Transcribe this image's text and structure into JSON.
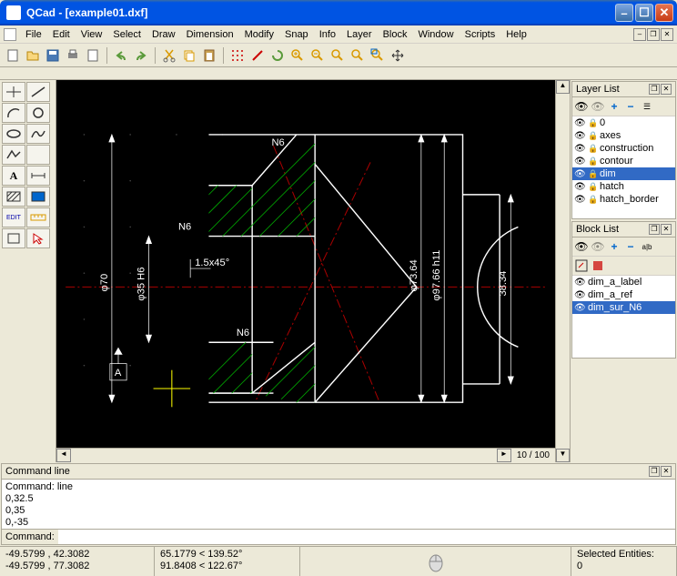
{
  "window": {
    "title": "QCad - [example01.dxf]"
  },
  "menu": [
    "File",
    "Edit",
    "View",
    "Select",
    "Draw",
    "Dimension",
    "Modify",
    "Snap",
    "Info",
    "Layer",
    "Block",
    "Window",
    "Scripts",
    "Help"
  ],
  "layers": {
    "title": "Layer List",
    "items": [
      {
        "name": "0",
        "sel": false
      },
      {
        "name": "axes",
        "sel": false
      },
      {
        "name": "construction",
        "sel": false
      },
      {
        "name": "contour",
        "sel": false
      },
      {
        "name": "dim",
        "sel": true
      },
      {
        "name": "hatch",
        "sel": false
      },
      {
        "name": "hatch_border",
        "sel": false
      }
    ]
  },
  "blocks": {
    "title": "Block List",
    "items": [
      {
        "name": "dim_a_label",
        "sel": false
      },
      {
        "name": "dim_a_ref",
        "sel": false
      },
      {
        "name": "dim_sur_N6",
        "sel": true
      }
    ]
  },
  "cmd": {
    "title": "Command line",
    "history": [
      "Command: line",
      "0,32.5",
      "0,35",
      "0,-35"
    ],
    "label": "Command:"
  },
  "status": {
    "coord1a": "-49.5799 , 42.3082",
    "coord1b": "-49.5799 , 77.3082",
    "coord2a": "65.1779 < 139.52°",
    "coord2b": "91.8408 < 122.67°",
    "sel_label": "Selected Entities:",
    "sel_count": "0"
  },
  "viewport": {
    "ratio": "10 / 100"
  },
  "drawing": {
    "labels": {
      "phi70": "φ70",
      "phi35": "φ35 H6",
      "phi73": "φ73.64",
      "phi97": "φ97.66 h11",
      "d38": "38.34",
      "ch": "1.5x45°",
      "n6a": "N6",
      "n6b": "N6",
      "n6c": "N6",
      "box": "A"
    }
  }
}
